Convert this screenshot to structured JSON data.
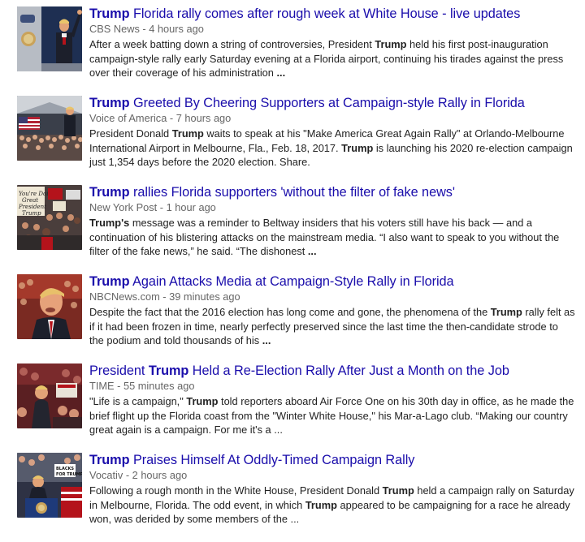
{
  "results": [
    {
      "title_kw": "Trump",
      "title_rest": " Florida rally comes after rough week at White House - live updates",
      "source": "CBS News",
      "time": "4 hours ago",
      "snippet_parts": [
        {
          "t": "After a week batting down a string of controversies, President ",
          "b": false
        },
        {
          "t": "Trump",
          "b": true
        },
        {
          "t": " held his first post-inauguration campaign-style rally early Saturday evening at a Florida airport, continuing his tirades against the press over their coverage of his administration ",
          "b": false
        },
        {
          "t": "...",
          "b": true
        }
      ],
      "thumb": "cbs-trump-airplane-stairs-image"
    },
    {
      "title_kw": "Trump",
      "title_rest": " Greeted By Cheering Supporters at Campaign-style Rally in Florida",
      "source": "Voice of America",
      "time": "7 hours ago",
      "snippet_parts": [
        {
          "t": "President Donald ",
          "b": false
        },
        {
          "t": "Trump",
          "b": true
        },
        {
          "t": " waits to speak at his \"Make America Great Again Rally\" at Orlando-Melbourne International Airport in Melbourne, Fla., Feb. 18, 2017. ",
          "b": false
        },
        {
          "t": "Trump",
          "b": true
        },
        {
          "t": " is launching his 2020 re-election campaign just 1,354 days before the 2020 election. Share.",
          "b": false
        }
      ],
      "thumb": "voa-rally-hangar-image"
    },
    {
      "title_kw": "Trump",
      "title_rest": " rallies Florida supporters 'without the filter of fake news'",
      "source": "New York Post",
      "time": "1 hour ago",
      "snippet_parts": [
        {
          "t": "Trump's",
          "b": true
        },
        {
          "t": " message was a reminder to Beltway insiders that his voters still have his back — and a continuation of his blistering attacks on the mainstream media. “I also want to speak to you without the filter of the fake news,” he said. “The dishonest ",
          "b": false
        },
        {
          "t": "...",
          "b": true
        }
      ],
      "thumb": "nypost-supporters-signs-image",
      "thumb_sign": "You're Doing Great President Trump"
    },
    {
      "title_kw": "Trump",
      "title_rest": " Again Attacks Media at Campaign-Style Rally in Florida",
      "source": "NBCNews.com",
      "time": "39 minutes ago",
      "snippet_parts": [
        {
          "t": "Despite the fact that the 2016 election has long come and gone, the phenomena of the ",
          "b": false
        },
        {
          "t": "Trump",
          "b": true
        },
        {
          "t": " rally felt as if it had been frozen in time, nearly perfectly preserved since the last time the then-candidate strode to the podium and told thousands of his ",
          "b": false
        },
        {
          "t": "...",
          "b": true
        }
      ],
      "thumb": "nbc-trump-speaking-image"
    },
    {
      "title_pre": "President ",
      "title_kw": "Trump",
      "title_rest": " Held a Re-Election Rally After Just a Month on the Job",
      "source": "TIME",
      "time": "55 minutes ago",
      "snippet_parts": [
        {
          "t": "\"Life is a campaign,\" ",
          "b": false
        },
        {
          "t": "Trump",
          "b": true
        },
        {
          "t": " told reporters aboard Air Force One on his 30th day in office, as he made the brief flight up the Florida coast from the \"Winter White House,\" his Mar-a-Lago club. “Making our country great again is a campaign. For me it's a ...",
          "b": false
        }
      ],
      "thumb": "time-rally-crowd-image"
    },
    {
      "title_kw": "Trump",
      "title_rest": " Praises Himself At Oddly-Timed Campaign Rally",
      "source": "Vocativ",
      "time": "2 hours ago",
      "snippet_parts": [
        {
          "t": "Following a rough month in the White House, President Donald ",
          "b": false
        },
        {
          "t": "Trump",
          "b": true
        },
        {
          "t": " held a campaign rally on Saturday in Melbourne, Florida. The odd event, in which ",
          "b": false
        },
        {
          "t": "Trump",
          "b": true
        },
        {
          "t": " appeared to be campaigning for a race he already won, was derided by some members of the ...",
          "b": false
        }
      ],
      "thumb": "vocativ-podium-crowd-image",
      "thumb_sign": "BLACKS FOR TRUMP"
    }
  ],
  "separator": " - ",
  "colors": {
    "link": "#1a0dab",
    "meta": "#666666",
    "text": "#222222"
  }
}
